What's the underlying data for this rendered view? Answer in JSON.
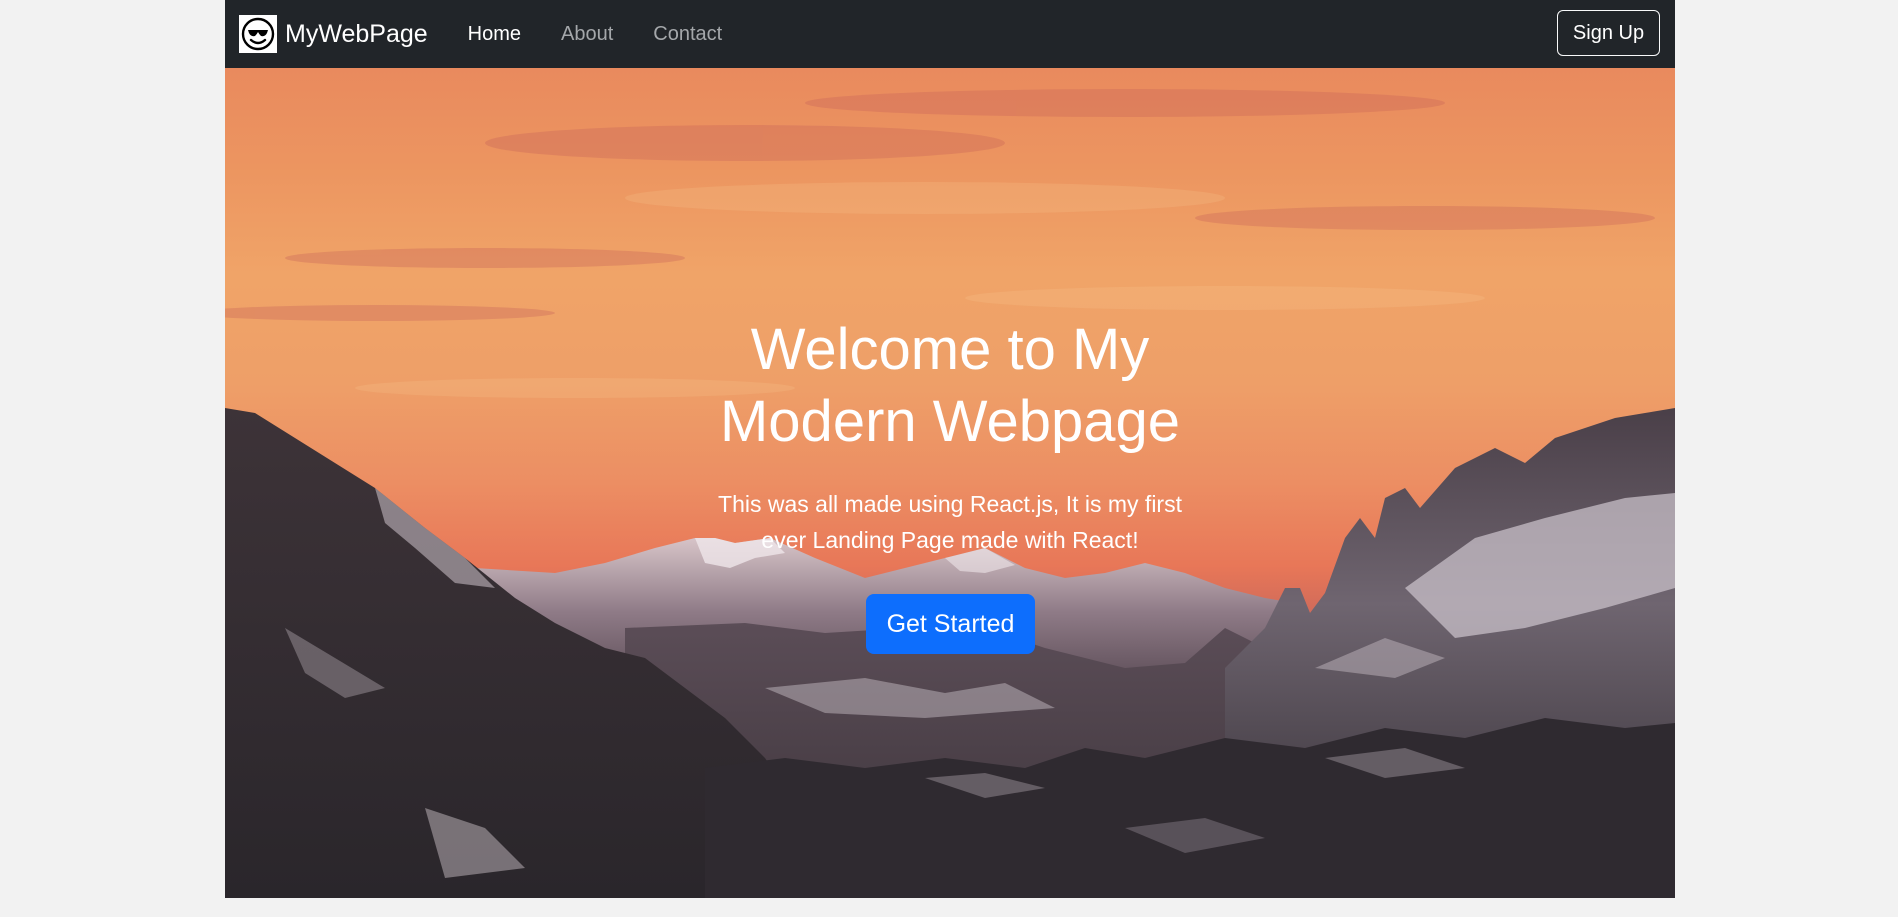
{
  "navbar": {
    "brand": "MyWebPage",
    "brand_icon": "smiley-sunglasses-icon",
    "links": [
      {
        "label": "Home",
        "active": true
      },
      {
        "label": "About",
        "active": false
      },
      {
        "label": "Contact",
        "active": false
      }
    ],
    "signup_label": "Sign Up"
  },
  "hero": {
    "title_line1": "Welcome to My",
    "title_line2": "Modern Webpage",
    "subtitle_line1": "This was all made using React.js, It is my first",
    "subtitle_line2": "ever Landing Page made with React!",
    "cta_label": "Get Started",
    "background": "mountain-sunset-photo"
  },
  "colors": {
    "navbar_bg": "#212529",
    "nav_inactive": "#a4a7aa",
    "cta_bg": "#0d6efd",
    "page_bg": "#f2f2f2"
  }
}
